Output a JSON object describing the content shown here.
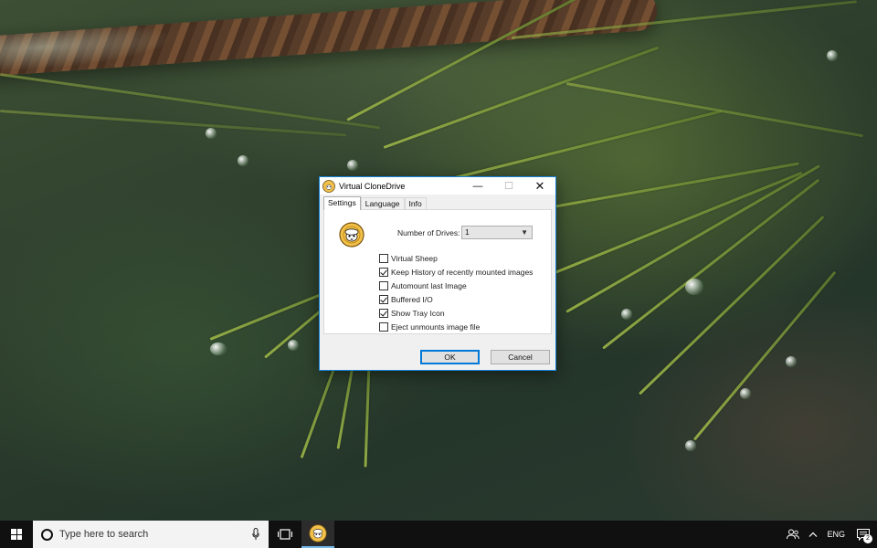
{
  "window": {
    "title": "Virtual CloneDrive",
    "minimize_glyph": "—",
    "maximize_glyph": "☐",
    "close_glyph": "✕",
    "accent": "#1883d7"
  },
  "tabs": [
    {
      "label": "Settings",
      "active": true
    },
    {
      "label": "Language",
      "active": false
    },
    {
      "label": "Info",
      "active": false
    }
  ],
  "settings": {
    "drives_label": "Number of Drives:",
    "drives_value": "1",
    "options": [
      {
        "label": "Virtual Sheep",
        "checked": false
      },
      {
        "label": "Keep History of recently mounted images",
        "checked": true
      },
      {
        "label": "Automount last Image",
        "checked": false
      },
      {
        "label": "Buffered I/O",
        "checked": true
      },
      {
        "label": "Show Tray Icon",
        "checked": true
      },
      {
        "label": "Eject unmounts image file",
        "checked": false
      }
    ]
  },
  "buttons": {
    "ok": "OK",
    "cancel": "Cancel"
  },
  "taskbar": {
    "search_placeholder": "Type here to search",
    "language": "ENG",
    "notification_count": "2",
    "icons": [
      "windows-start-icon",
      "cortana-icon",
      "microphone-icon",
      "task-view-icon",
      "sheep-app-icon",
      "people-icon",
      "chevron-up-icon",
      "notification-icon"
    ]
  }
}
